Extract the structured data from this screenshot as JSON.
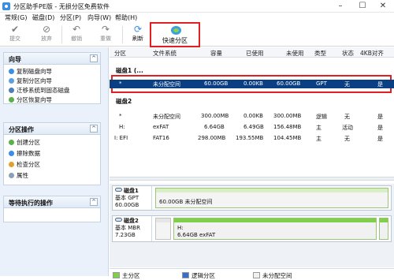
{
  "window": {
    "title": "分区助手PE版 - 无损分区免费软件"
  },
  "menu": [
    {
      "label": "常规(G)"
    },
    {
      "label": "磁盘(D)"
    },
    {
      "label": "分区(P)"
    },
    {
      "label": "向导(W)"
    },
    {
      "label": "帮助(H)"
    }
  ],
  "toolbar": {
    "submit": "提交",
    "discard": "放弃",
    "undo": "撤销",
    "redo": "重做",
    "refresh": "刷新",
    "fast_partition": "快速分区"
  },
  "sidebar": {
    "wizard": {
      "title": "向导",
      "items": [
        "复制磁盘向导",
        "复制分区向导",
        "迁移系统到固态磁盘",
        "分区恢复向导"
      ]
    },
    "operations": {
      "title": "分区操作",
      "items": [
        "创建分区",
        "擦除数据",
        "检查分区",
        "属性"
      ]
    },
    "pending": {
      "title": "等待执行的操作"
    }
  },
  "columns": [
    "分区",
    "文件系统",
    "容量",
    "已使用",
    "未使用",
    "类型",
    "状态",
    "4KB对齐"
  ],
  "disks": [
    {
      "label": "磁盘1 (...",
      "rows": [
        {
          "partition": "*",
          "fs": "未分配空间",
          "capacity": "60.00GB",
          "used": "0.00KB",
          "free": "60.00GB",
          "type": "GPT",
          "status": "无",
          "align": "是"
        }
      ]
    },
    {
      "label": "磁盘2",
      "rows": [
        {
          "partition": "*",
          "fs": "未分配空间",
          "capacity": "300.00MB",
          "used": "0.00KB",
          "free": "300.00MB",
          "type": "逻辑",
          "status": "无",
          "align": "是"
        },
        {
          "partition": "H:",
          "fs": "exFAT",
          "capacity": "6.64GB",
          "used": "6.49GB",
          "free": "156.48MB",
          "type": "主",
          "status": "活动",
          "align": "是"
        },
        {
          "partition": "I: EFI",
          "fs": "FAT16",
          "capacity": "298.00MB",
          "used": "193.55MB",
          "free": "104.45MB",
          "type": "主",
          "status": "无",
          "align": "是"
        }
      ]
    }
  ],
  "disk_map": [
    {
      "name": "磁盘1",
      "style": "基本 GPT",
      "size": "60.00GB",
      "partitions": [
        {
          "name": "",
          "detail": "60.00GB 未分配空间"
        }
      ]
    },
    {
      "name": "磁盘2",
      "style": "基本 MBR",
      "size": "7.23GB",
      "partitions": [
        {
          "name": "",
          "detail": ""
        },
        {
          "name": "H:",
          "detail": "6.64GB exFAT"
        },
        {
          "name": "",
          "detail": ""
        }
      ]
    }
  ],
  "legend": [
    {
      "label": "主分区",
      "color": "#7fcf4a"
    },
    {
      "label": "逻辑分区",
      "color": "#3a6fc8"
    },
    {
      "label": "未分配空间",
      "color": "#f1f1f1"
    }
  ],
  "colors": {
    "accent": "#0a3f83",
    "highlight": "#e02020"
  }
}
